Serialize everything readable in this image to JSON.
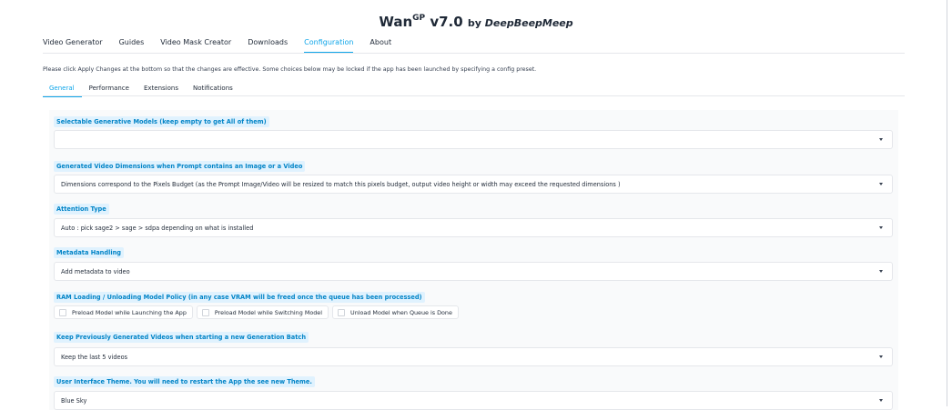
{
  "header": {
    "title": "Wan",
    "sup": "GP",
    "version": " v7.0 ",
    "by": "by ",
    "author": "DeepBeepMeep"
  },
  "nav": {
    "tabs": [
      {
        "label": "Video Generator"
      },
      {
        "label": "Guides"
      },
      {
        "label": "Video Mask Creator"
      },
      {
        "label": "Downloads"
      },
      {
        "label": "Configuration",
        "active": true
      },
      {
        "label": "About"
      }
    ]
  },
  "notice": "Please click Apply Changes at the bottom so that the changes are effective. Some choices below may be locked if the app has been launched by specifying a config preset.",
  "subnav": {
    "tabs": [
      {
        "label": "General",
        "active": true
      },
      {
        "label": "Performance"
      },
      {
        "label": "Extensions"
      },
      {
        "label": "Notifications"
      }
    ]
  },
  "sections": [
    {
      "label": "Selectable Generative Models (keep empty to get All of them)",
      "value": ""
    },
    {
      "label": "Generated Video Dimensions when Prompt contains an Image or a Video",
      "value": "Dimensions correspond to the Pixels Budget (as the Prompt Image/Video will be resized to match this pixels budget, output video height or width may exceed the requested dimensions )"
    },
    {
      "label": "Attention Type",
      "value": "Auto : pick sage2 > sage > sdpa depending on what is installed"
    },
    {
      "label": "Metadata Handling",
      "value": "Add metadata to video"
    },
    {
      "label": "RAM Loading / Unloading Model Policy (in any case VRAM will be freed once the queue has been processed)",
      "checkboxes": [
        {
          "label": "Preload Model while Launching the App"
        },
        {
          "label": "Preload Model while Switching Model"
        },
        {
          "label": "Unload Model when Queue is Done"
        }
      ]
    },
    {
      "label": "Keep Previously Generated Videos when starting a new Generation Batch",
      "value": "Keep the last 5 videos"
    },
    {
      "label": "User Interface Theme. You will need to restart the App the see new Theme.",
      "value": "Blue Sky"
    }
  ],
  "colors": {
    "accent": "#0ea5e9",
    "label_bg": "#e0f2fe",
    "label_text": "#0284c7"
  },
  "icons": {
    "dropdown": "chevron-down-icon"
  }
}
